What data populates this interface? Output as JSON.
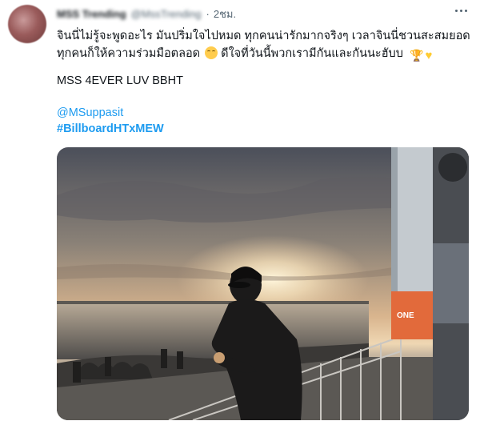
{
  "tweet": {
    "author": {
      "display_name": "MSS Trending",
      "handle": "@MssTrending"
    },
    "separator": "·",
    "time": "2ชม.",
    "more_icon": "more-horizontal-icon",
    "text_lines": [
      "จินนี่ไม่รู้จะพูดอะไร มันปริ่มใจไปหมด ทุกคนน่ารักมากจริงๆ เวลาจินนี่ชวนสะสมยอด",
      "ทุกคนก็ให้ความร่วมมือตลอด",
      "ดีใจที่วันนี้พวกเรามีกันและกันนะฮับบ"
    ],
    "emojis": [
      "relieved-face-emoji",
      "trophy-emoji",
      "yellow-heart-emoji"
    ],
    "tagline": "MSS 4EVER LUV BBHT",
    "mention": "@MSuppasit",
    "hashtag": "#BillboardHTxMEW",
    "colors": {
      "link": "#1d9bf0",
      "text": "#0f1419",
      "secondary": "#536471"
    }
  }
}
